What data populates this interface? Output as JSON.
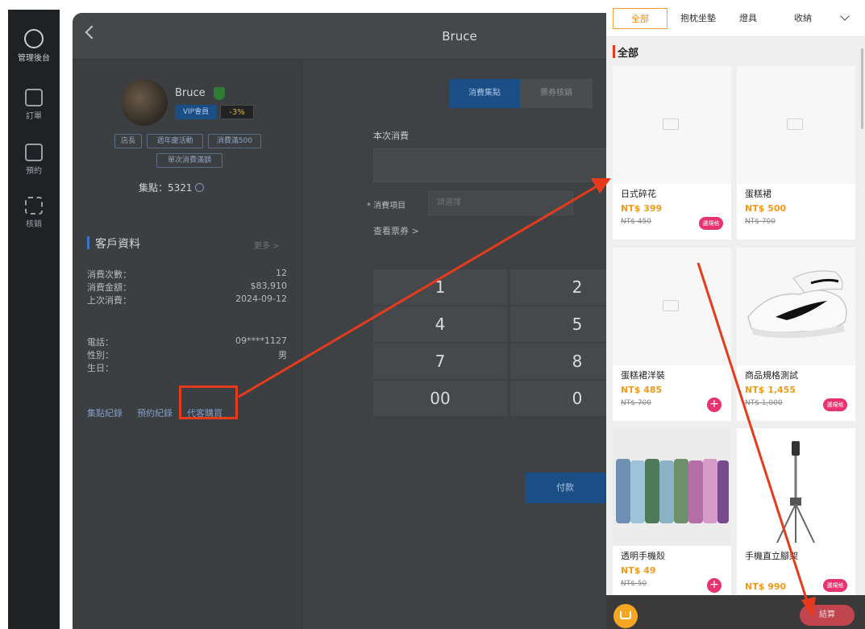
{
  "nav": {
    "items": [
      {
        "label": "管理後台",
        "icon": "users-icon"
      },
      {
        "label": "訂單",
        "icon": "clipboard-icon"
      },
      {
        "label": "預約",
        "icon": "calendar-icon"
      },
      {
        "label": "核銷",
        "icon": "scan-icon"
      }
    ]
  },
  "header": {
    "title": "Bruce"
  },
  "profile": {
    "name": "Bruce",
    "vip": "VIP會員",
    "discount": "-3%",
    "tags": [
      "店長",
      "週年慶活動",
      "消費滿500",
      "單次消費滿額"
    ],
    "points": "集點：5321",
    "section_title": "客戶資料",
    "more": "更多 >",
    "stats": [
      {
        "label": "消費次數：",
        "value": "12"
      },
      {
        "label": "消費金額：",
        "value": "$83,910"
      },
      {
        "label": "上次消費：",
        "value": "2024-09-12"
      }
    ],
    "contact": [
      {
        "label": "電話：",
        "value": "09****1127"
      },
      {
        "label": "性別：",
        "value": "男"
      },
      {
        "label": "生日：",
        "value": ""
      }
    ],
    "links": [
      "集點紀錄",
      "預約紀錄",
      "代客購買"
    ]
  },
  "form": {
    "tabs": [
      "消費集點",
      "票券核銷"
    ],
    "amount_label": "本次消費",
    "item_label": "* 消費項目",
    "item_placeholder": "請選擇",
    "voucher_link": "查看票券 >",
    "keys": [
      "1",
      "2",
      "4",
      "5",
      "7",
      "8",
      "00",
      "0"
    ],
    "pay": "付款"
  },
  "panel": {
    "tabs": [
      "全部",
      "抱枕坐墊",
      "燈具",
      "收納"
    ],
    "section_heading": "全部",
    "checkout": "結算",
    "products": [
      {
        "name": "日式碎花",
        "price": "NT$ 399",
        "original": "NT$ 450",
        "action": "spec",
        "action_label": "選規格"
      },
      {
        "name": "蛋糕裙",
        "price": "NT$ 500",
        "original": "NT$ 700",
        "action": "none",
        "action_label": ""
      },
      {
        "name": "蛋糕裙洋裝",
        "price": "NT$ 485",
        "original": "NT$ 700",
        "action": "plus",
        "action_label": "+"
      },
      {
        "name": "商品規格測試",
        "price": "NT$ 1,455",
        "original": "NT$ 1,000",
        "action": "spec",
        "action_label": "選規格"
      },
      {
        "name": "透明手機殼",
        "price": "NT$ 49",
        "original": "NT$ 50",
        "action": "plus",
        "action_label": "+"
      },
      {
        "name": "手機直立腳架",
        "price": "NT$ 990",
        "original": "",
        "action": "spec",
        "action_label": "選規格"
      }
    ]
  },
  "colors": {
    "accent": "#f08a00",
    "brand": "#1b4e85",
    "annotation": "#e53b1c",
    "pink": "#e8336e"
  }
}
